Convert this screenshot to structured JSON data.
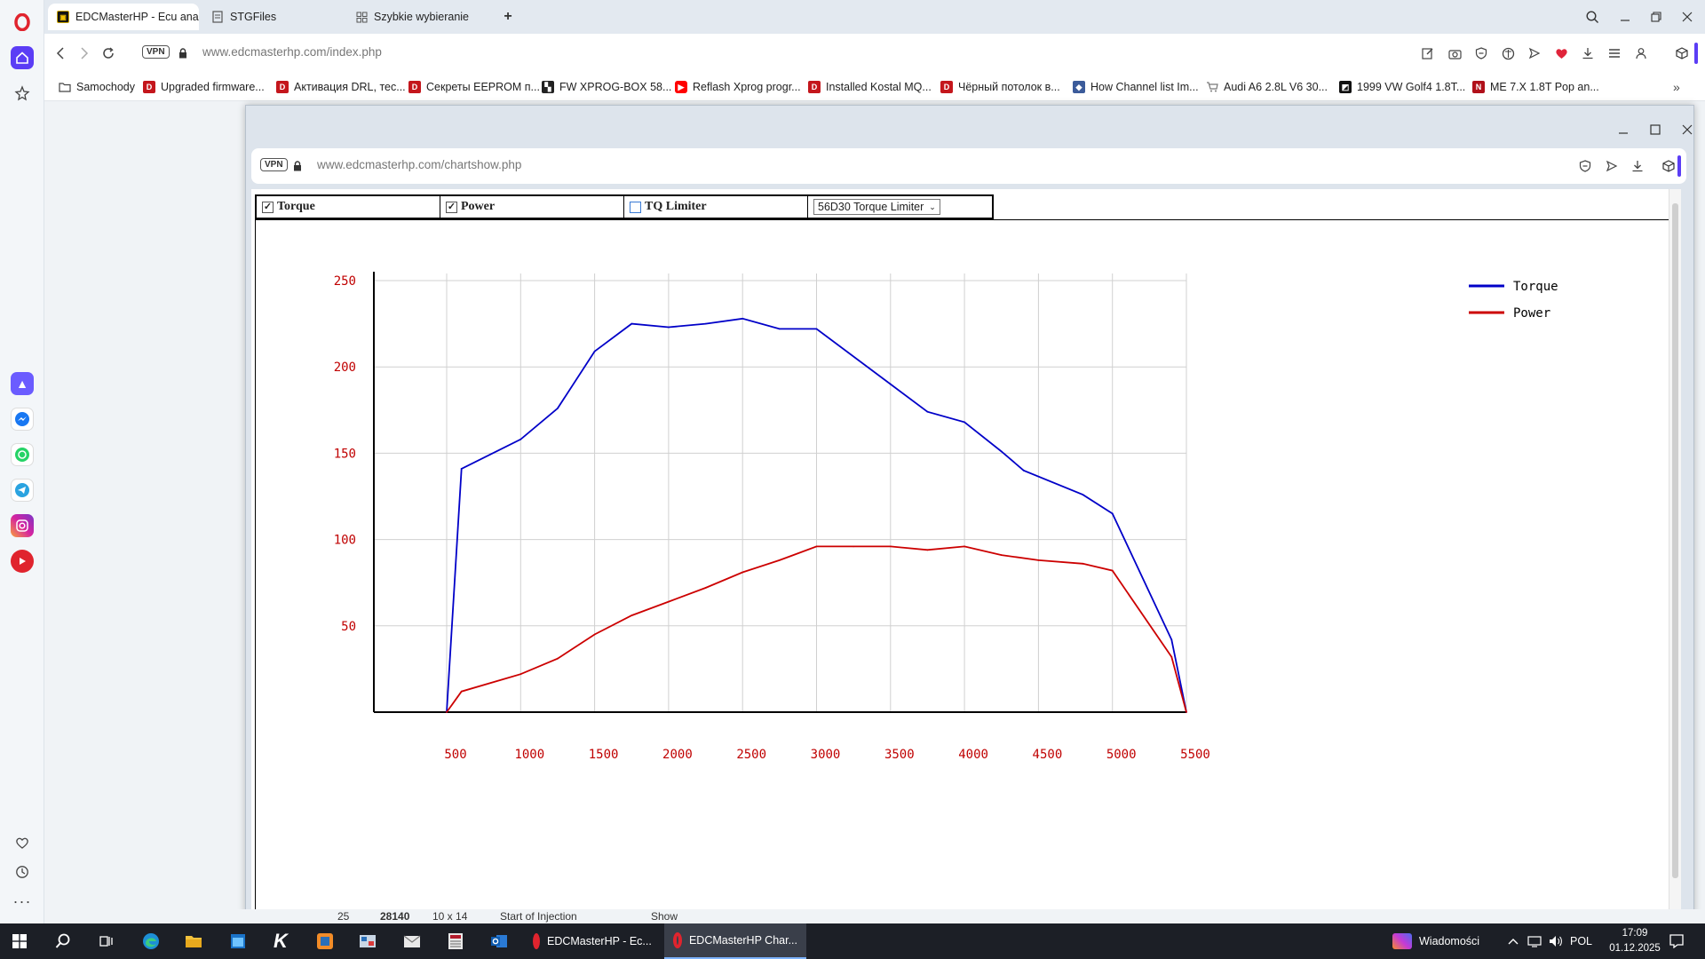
{
  "browser": {
    "tabs": [
      {
        "label": "EDCMasterHP - Ecu analy",
        "active": true,
        "favicon": "edc-favicon"
      },
      {
        "label": "STGFiles",
        "active": false,
        "favicon": "page-icon"
      },
      {
        "label": "Szybkie wybieranie",
        "active": false,
        "favicon": "grid-icon"
      }
    ],
    "new_tab_symbol": "+",
    "url_host": "www.edcmasterhp.com",
    "url_path": "/index.php",
    "vpn_label": "VPN"
  },
  "bookmarks": [
    {
      "label": "Samochody",
      "icon": "folder-icon"
    },
    {
      "label": "Upgraded firmware...",
      "icon": "d-icon"
    },
    {
      "label": "Активация DRL, тес...",
      "icon": "d-icon"
    },
    {
      "label": "Секреты EEPROM п...",
      "icon": "d-icon"
    },
    {
      "label": "FW XPROG-BOX 58...",
      "icon": "xprog-icon"
    },
    {
      "label": "Reflash Xprog progr...",
      "icon": "youtube-icon"
    },
    {
      "label": "Installed Kostal MQ...",
      "icon": "d-icon"
    },
    {
      "label": "Чёрный потолок в...",
      "icon": "d-icon"
    },
    {
      "label": "How Channel list Im...",
      "icon": "cube-icon"
    },
    {
      "label": "Audi A6 2.8L V6 30...",
      "icon": "cart-icon"
    },
    {
      "label": "1999 VW Golf4 1.8T...",
      "icon": "golf-icon"
    },
    {
      "label": "ME 7.X 1.8T Pop an...",
      "icon": "me-icon"
    }
  ],
  "popup": {
    "url_host": "www.edcmasterhp.com",
    "url_path": "/chartshow.php",
    "vpn_label": "VPN",
    "controls": [
      {
        "label": "Torque",
        "checked": true
      },
      {
        "label": "Power",
        "checked": true
      },
      {
        "label": "TQ Limiter",
        "checked": false
      }
    ],
    "select_value": "56D30 Torque Limiter"
  },
  "chart_data": {
    "type": "line",
    "title": "",
    "xlabel": "",
    "ylabel": "",
    "xlim": [
      0,
      5500
    ],
    "ylim": [
      0,
      250
    ],
    "x_ticks": [
      "500",
      "1000",
      "1500",
      "2000",
      "2500",
      "3000",
      "3500",
      "4000",
      "4500",
      "5000",
      "5500"
    ],
    "y_ticks": [
      "50",
      "100",
      "150",
      "200",
      "250"
    ],
    "grid": true,
    "legend_position": "top-right",
    "series": [
      {
        "name": "Torque",
        "color": "#0000c8",
        "points": [
          [
            500,
            0
          ],
          [
            600,
            141
          ],
          [
            1000,
            158
          ],
          [
            1250,
            176
          ],
          [
            1500,
            209
          ],
          [
            1750,
            225
          ],
          [
            2000,
            223
          ],
          [
            2250,
            225
          ],
          [
            2500,
            228
          ],
          [
            2750,
            222
          ],
          [
            3000,
            222
          ],
          [
            3500,
            190
          ],
          [
            3750,
            174
          ],
          [
            4000,
            168
          ],
          [
            4250,
            151
          ],
          [
            4400,
            140
          ],
          [
            4800,
            126
          ],
          [
            5000,
            115
          ],
          [
            5400,
            42
          ],
          [
            5500,
            0
          ]
        ]
      },
      {
        "name": "Power",
        "color": "#cc0000",
        "points": [
          [
            500,
            0
          ],
          [
            600,
            12
          ],
          [
            1000,
            22
          ],
          [
            1250,
            31
          ],
          [
            1500,
            45
          ],
          [
            1750,
            56
          ],
          [
            2000,
            64
          ],
          [
            2250,
            72
          ],
          [
            2500,
            81
          ],
          [
            2750,
            88
          ],
          [
            3000,
            96
          ],
          [
            3250,
            96
          ],
          [
            3500,
            96
          ],
          [
            3750,
            94
          ],
          [
            4000,
            96
          ],
          [
            4250,
            91
          ],
          [
            4500,
            88
          ],
          [
            4800,
            86
          ],
          [
            5000,
            82
          ],
          [
            5400,
            32
          ],
          [
            5500,
            0
          ]
        ]
      }
    ]
  },
  "under_strip": {
    "cells": [
      "25",
      "28140",
      "10 x 14",
      "Start of Injection",
      "",
      "Show"
    ]
  },
  "taskbar": {
    "apps": [
      {
        "label": "EDCMasterHP - Ec...",
        "active": false
      },
      {
        "label": "EDCMasterHP Char...",
        "active": true
      }
    ],
    "news_label": "Wiadomości",
    "language": "POL",
    "time": "17:09",
    "date": "01.12.2025"
  }
}
